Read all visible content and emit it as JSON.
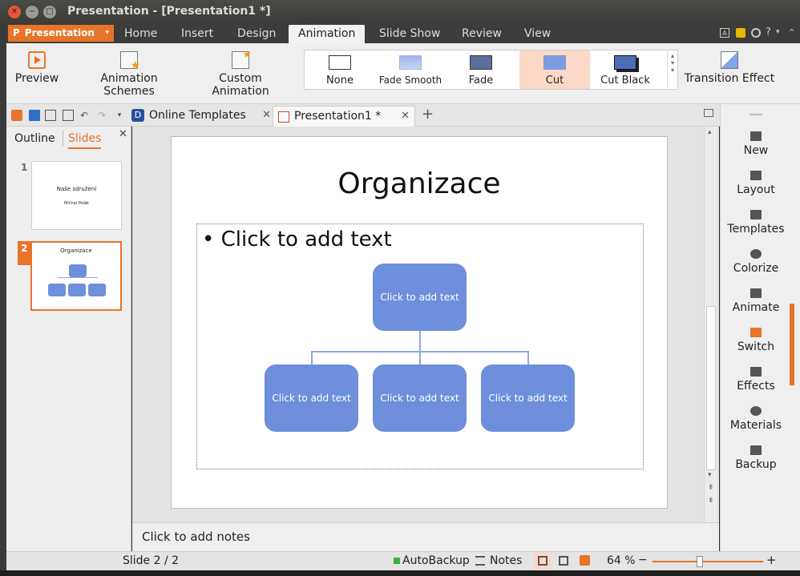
{
  "window": {
    "title": "Presentation - [Presentation1 *]"
  },
  "menu": {
    "app_button": "Presentation",
    "tabs": [
      "Home",
      "Insert",
      "Design",
      "Animation",
      "Slide Show",
      "Review",
      "View"
    ],
    "active_tab": "Animation",
    "right_icons": [
      "A",
      "?"
    ]
  },
  "ribbon": {
    "preview": "Preview",
    "animation_schemes": "Animation Schemes",
    "custom_animation": "Custom Animation",
    "transitions": [
      "None",
      "Fade Smooth",
      "Fade",
      "Cut",
      "Cut Black"
    ],
    "selected_transition": "Cut",
    "transition_effect": "Transition Effect"
  },
  "doc_tabs": {
    "online_templates": "Online Templates",
    "presentation": "Presentation1 *",
    "add": "+"
  },
  "left_pane": {
    "tab_outline": "Outline",
    "tab_slides": "Slides",
    "close": "✕",
    "slides": [
      {
        "number": "1",
        "title": "Naše sdružení",
        "subtitle": "Michal Polák"
      },
      {
        "number": "2",
        "title": "Organizace"
      }
    ]
  },
  "slide": {
    "title": "Organizace",
    "bullet": "Click to add text",
    "org_boxes": [
      "Click to add text",
      "Click to add text",
      "Click to add text",
      "Click to add text"
    ]
  },
  "notes": {
    "placeholder": "Click to add notes"
  },
  "right_sidebar": {
    "items": [
      "New",
      "Layout",
      "Templates",
      "Colorize",
      "Animate",
      "Switch",
      "Effects",
      "Materials",
      "Backup"
    ]
  },
  "status": {
    "slide_indicator": "Slide 2 / 2",
    "autobackup": "AutoBackup",
    "notes": "Notes",
    "zoom": "64 %",
    "zoom_level": 0.42,
    "minus": "−",
    "plus": "+"
  },
  "colors": {
    "accent": "#e8742a",
    "smartart": "#6d8fdc",
    "selected_transition_bg": "#fbd9c6"
  }
}
